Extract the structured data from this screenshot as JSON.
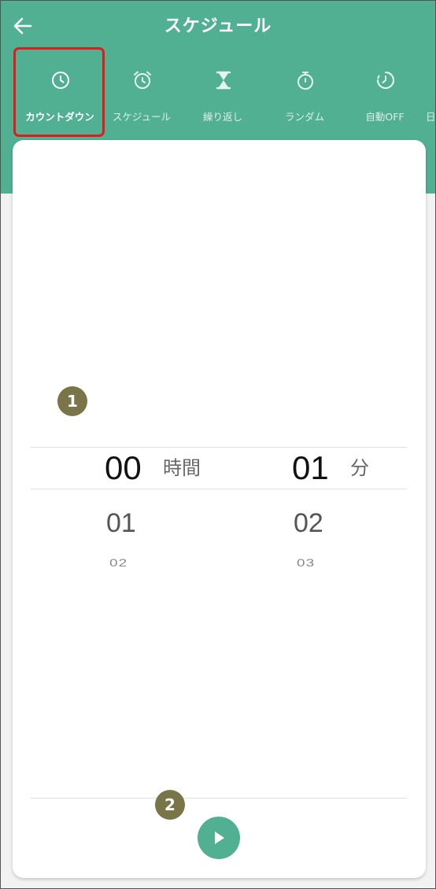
{
  "header": {
    "title": "スケジュール",
    "background_color": "#51b092"
  },
  "tabs": [
    {
      "label": "カウントダウン",
      "icon": "clock-icon",
      "active": true
    },
    {
      "label": "スケジュール",
      "icon": "alarm-clock-icon",
      "active": false
    },
    {
      "label": "繰り返し",
      "icon": "hourglass-icon",
      "active": false
    },
    {
      "label": "ランダム",
      "icon": "stopwatch-icon",
      "active": false
    },
    {
      "label": "自動OFF",
      "icon": "timer-icon",
      "active": false
    },
    {
      "label": "日",
      "icon": "",
      "active": false
    }
  ],
  "annotations": {
    "marker_1": "1",
    "marker_2": "2",
    "highlight_color": "#e01b1b"
  },
  "picker": {
    "hours": {
      "selected": "00",
      "next": "01",
      "next2": "02",
      "unit": "時間"
    },
    "minutes": {
      "selected": "01",
      "next": "02",
      "next2": "03",
      "unit": "分"
    }
  },
  "controls": {
    "play_icon": "play-icon"
  }
}
